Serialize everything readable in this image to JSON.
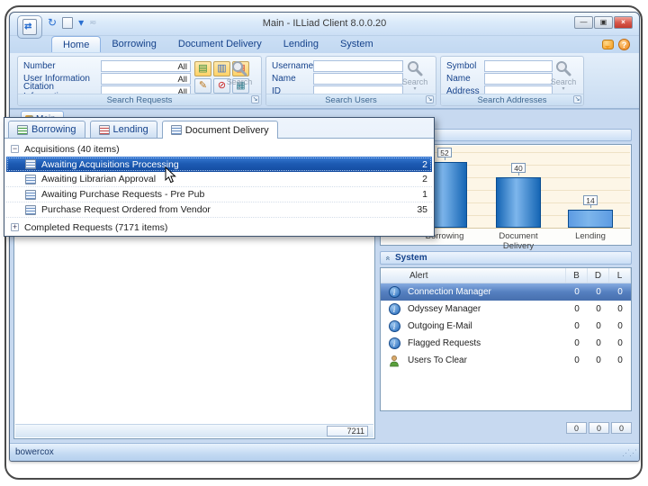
{
  "window": {
    "title": "Main - ILLiad Client 8.0.0.20",
    "controls": {
      "minimize": "—",
      "maximize": "▣",
      "close": "×"
    }
  },
  "icons": {
    "sync": "↻",
    "qat_overflow": "▾",
    "launcher": "↘",
    "chevron": "«",
    "info": "i",
    "help": "?",
    "toolbar": [
      "▤",
      "▥",
      "▤",
      "✎",
      "⊘",
      "▦"
    ],
    "grip": "⋰⋰"
  },
  "ribbon": {
    "tabs": [
      {
        "label": "Home",
        "active": true
      },
      {
        "label": "Borrowing"
      },
      {
        "label": "Document Delivery"
      },
      {
        "label": "Lending"
      },
      {
        "label": "System"
      }
    ],
    "groups": {
      "requests": {
        "caption": "Search Requests",
        "search_label": "Search",
        "fields": [
          {
            "label": "Number",
            "value": "All"
          },
          {
            "label": "User Information",
            "value": "All"
          },
          {
            "label": "Citation Information",
            "value": "All"
          }
        ]
      },
      "users": {
        "caption": "Search Users",
        "search_label": "Search",
        "fields": [
          {
            "label": "Username",
            "value": ""
          },
          {
            "label": "Name",
            "value": ""
          },
          {
            "label": "ID",
            "value": ""
          }
        ]
      },
      "addresses": {
        "caption": "Search Addresses",
        "search_label": "Search",
        "fields": [
          {
            "label": "Symbol",
            "value": ""
          },
          {
            "label": "Name",
            "value": ""
          },
          {
            "label": "Address",
            "value": ""
          }
        ]
      }
    }
  },
  "workspace": {
    "main_tab_label": "Main",
    "left_panel_footer_value": "7211"
  },
  "popup": {
    "tabs": [
      {
        "label": "Borrowing",
        "active": false
      },
      {
        "label": "Lending",
        "active": false
      },
      {
        "label": "Document Delivery",
        "active": true
      }
    ],
    "group_expanded_label": "Acquisitions  (40 items)",
    "rows": [
      {
        "label": "Awaiting Acquisitions Processing",
        "count": "2",
        "selected": true
      },
      {
        "label": "Awaiting Librarian Approval",
        "count": "2",
        "selected": false
      },
      {
        "label": "Awaiting Purchase Requests - Pre Pub",
        "count": "1",
        "selected": false
      },
      {
        "label": "Purchase Request Ordered from Vendor",
        "count": "35",
        "selected": false
      }
    ],
    "group_collapsed_label": "Completed Requests  (7171 items)"
  },
  "chart_data": {
    "type": "bar",
    "categories": [
      "Borrowing",
      "Document Delivery",
      "Lending"
    ],
    "values": [
      52,
      40,
      14
    ],
    "title": "",
    "xlabel": "",
    "ylabel": "",
    "ylim": [
      0,
      60
    ],
    "grid": true,
    "legend_position": "none",
    "bar_colors": [
      "#1565b4",
      "#1565b4",
      "#5d9be2"
    ]
  },
  "system_panel": {
    "header": "System",
    "columns": [
      "Alert",
      "B",
      "D",
      "L"
    ],
    "rows": [
      {
        "icon": "info",
        "label": "Connection Manager",
        "b": "0",
        "d": "0",
        "l": "0",
        "selected": true
      },
      {
        "icon": "info",
        "label": "Odyssey Manager",
        "b": "0",
        "d": "0",
        "l": "0",
        "selected": false
      },
      {
        "icon": "info",
        "label": "Outgoing E-Mail",
        "b": "0",
        "d": "0",
        "l": "0",
        "selected": false
      },
      {
        "icon": "info",
        "label": "Flagged Requests",
        "b": "0",
        "d": "0",
        "l": "0",
        "selected": false
      },
      {
        "icon": "users",
        "label": "Users To Clear",
        "b": "0",
        "d": "0",
        "l": "0",
        "selected": false
      }
    ],
    "footer": [
      "0",
      "0",
      "0"
    ]
  },
  "statusbar": {
    "user": "bowercox"
  },
  "colors": {
    "accent": "#15428b",
    "selection_dark": "#1d5cb4",
    "selection_medium": "#5580c0",
    "chart_background": "#fdf6e7",
    "bar_dark": "#1565b4",
    "bar_light": "#5d9be2",
    "close_button": "#c23a2e"
  }
}
